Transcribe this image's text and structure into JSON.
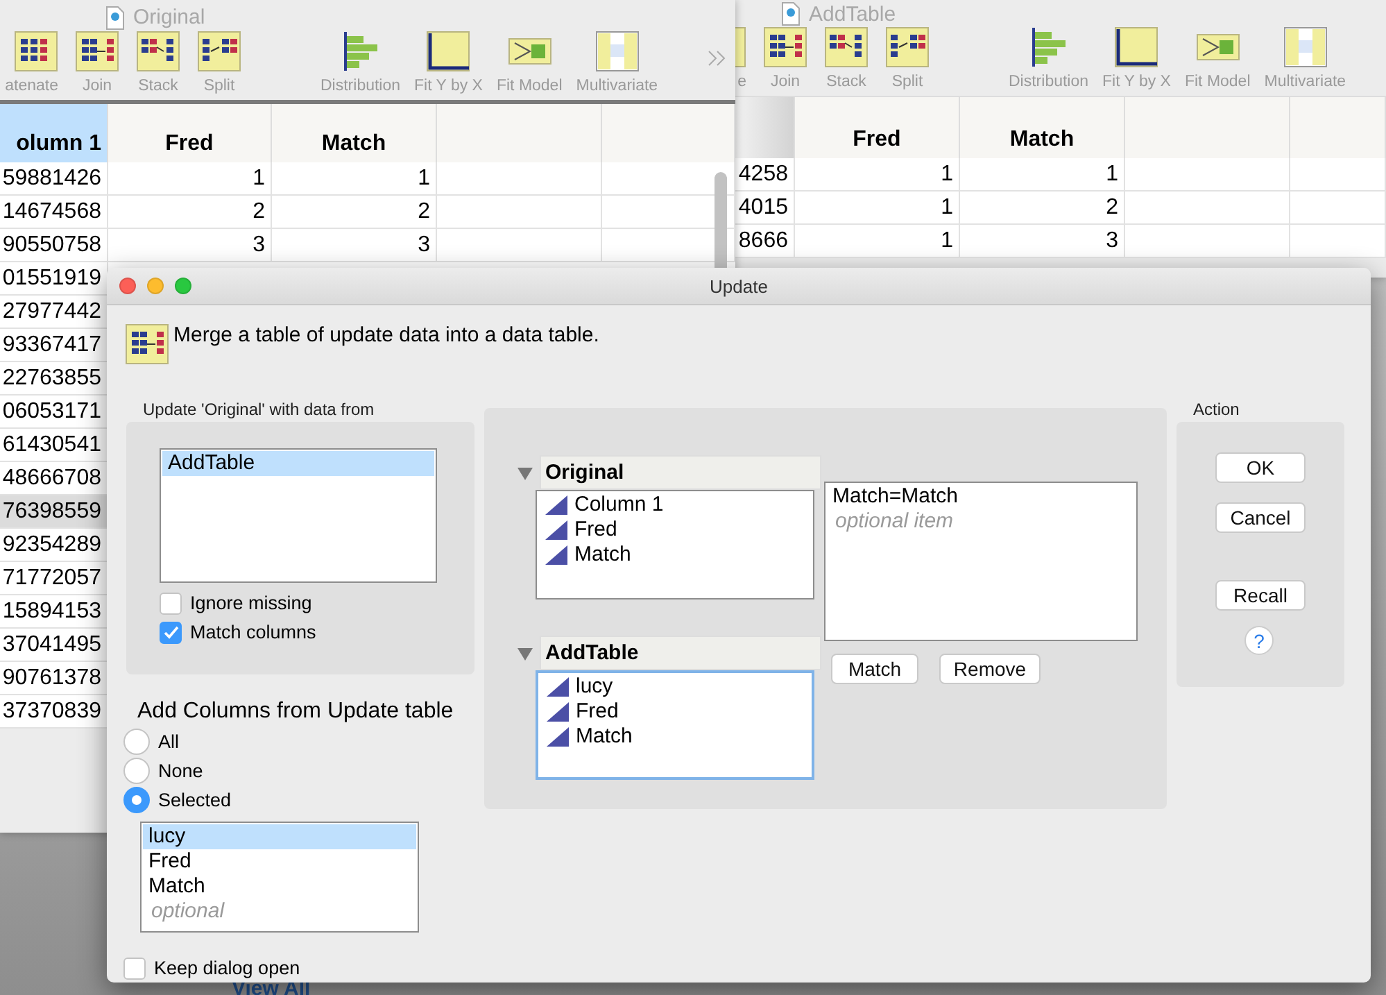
{
  "windows": [
    {
      "title": "Original",
      "toolbar": [
        {
          "label": "atenate",
          "kind": "concatenate"
        },
        {
          "label": "Join",
          "kind": "join"
        },
        {
          "label": "Stack",
          "kind": "stack"
        },
        {
          "label": "Split",
          "kind": "split"
        },
        {
          "label": "Distribution",
          "kind": "distribution"
        },
        {
          "label": "Fit Y by X",
          "kind": "fit"
        },
        {
          "label": "Fit Model",
          "kind": "model"
        },
        {
          "label": "Multivariate",
          "kind": "multivariate"
        }
      ],
      "columns": [
        {
          "label": "olumn 1",
          "selected": true
        },
        {
          "label": "Fred",
          "selected": false
        },
        {
          "label": "Match",
          "selected": false
        },
        {
          "selected": false
        },
        {
          "selected": false
        }
      ],
      "rows": [
        {
          "cells": [
            "59881426",
            "1",
            "1"
          ],
          "selected": false
        },
        {
          "cells": [
            "14674568",
            "2",
            "2"
          ],
          "selected": false
        },
        {
          "cells": [
            "90550758",
            "3",
            "3"
          ],
          "selected": false
        },
        {
          "cells": [
            "01551919"
          ],
          "selected": false
        },
        {
          "cells": [
            "27977442"
          ],
          "selected": false
        },
        {
          "cells": [
            "93367417"
          ],
          "selected": false
        },
        {
          "cells": [
            "22763855"
          ],
          "selected": false
        },
        {
          "cells": [
            "06053171"
          ],
          "selected": false
        },
        {
          "cells": [
            "61430541"
          ],
          "selected": false
        },
        {
          "cells": [
            "48666708"
          ],
          "selected": false
        },
        {
          "cells": [
            "76398559"
          ],
          "selected": true
        },
        {
          "cells": [
            "92354289"
          ],
          "selected": false
        },
        {
          "cells": [
            "71772057"
          ],
          "selected": false
        },
        {
          "cells": [
            "15894153"
          ],
          "selected": false
        },
        {
          "cells": [
            "37041495"
          ],
          "selected": false
        },
        {
          "cells": [
            "90761378"
          ],
          "selected": false
        },
        {
          "cells": [
            "37370839"
          ],
          "selected": false
        }
      ]
    },
    {
      "title": "AddTable",
      "toolbar": [
        {
          "label": "e",
          "kind": "concatenate"
        },
        {
          "label": "Join",
          "kind": "join"
        },
        {
          "label": "Stack",
          "kind": "stack"
        },
        {
          "label": "Split",
          "kind": "split"
        },
        {
          "label": "Distribution",
          "kind": "distribution"
        },
        {
          "label": "Fit Y by X",
          "kind": "fit"
        },
        {
          "label": "Fit Model",
          "kind": "model"
        },
        {
          "label": "Multivariate",
          "kind": "multivariate"
        }
      ],
      "columns": [
        {
          "selected": false
        },
        {
          "label": "Fred",
          "selected": false
        },
        {
          "label": "Match",
          "selected": false
        },
        {
          "selected": false
        },
        {
          "selected": false
        }
      ],
      "rows": [
        {
          "cells": [
            "4258",
            "1",
            "1"
          ],
          "selected": false
        },
        {
          "cells": [
            "4015",
            "1",
            "2"
          ],
          "selected": false
        },
        {
          "cells": [
            "8666",
            "1",
            "3"
          ],
          "selected": false
        }
      ]
    }
  ],
  "dialog": {
    "title": "Update",
    "description": "Merge a table of update data into a data table.",
    "source": {
      "label": "Update 'Original' with data from",
      "tables": [
        {
          "label": "AddTable",
          "selected": true
        }
      ],
      "options": [
        {
          "label": "Ignore missing",
          "checked": false
        },
        {
          "label": "Match columns",
          "checked": true
        }
      ]
    },
    "add_columns": {
      "label": "Add Columns from Update table",
      "modes": [
        {
          "label": "All",
          "selected": false
        },
        {
          "label": "None",
          "selected": false
        },
        {
          "label": "Selected",
          "selected": true
        }
      ],
      "columns": [
        {
          "label": "lucy",
          "selected": true
        },
        {
          "label": "Fred",
          "selected": false
        },
        {
          "label": "Match",
          "selected": false
        }
      ],
      "placeholder": "optional"
    },
    "match": {
      "tables": [
        {
          "name": "Original",
          "expanded": true,
          "focused": false,
          "columns": [
            "Column 1",
            "Fred",
            "Match"
          ]
        },
        {
          "name": "AddTable",
          "expanded": true,
          "focused": true,
          "columns": [
            "lucy",
            "Fred",
            "Match"
          ]
        }
      ],
      "pairs": [
        "Match=Match"
      ],
      "placeholder": "optional item",
      "buttons": [
        "Match",
        "Remove"
      ]
    },
    "action": {
      "label": "Action",
      "buttons": [
        "OK",
        "Cancel",
        "Recall"
      ],
      "help": "?"
    },
    "keep_open": {
      "label": "Keep dialog open",
      "checked": false
    }
  },
  "footer_link": "View All"
}
